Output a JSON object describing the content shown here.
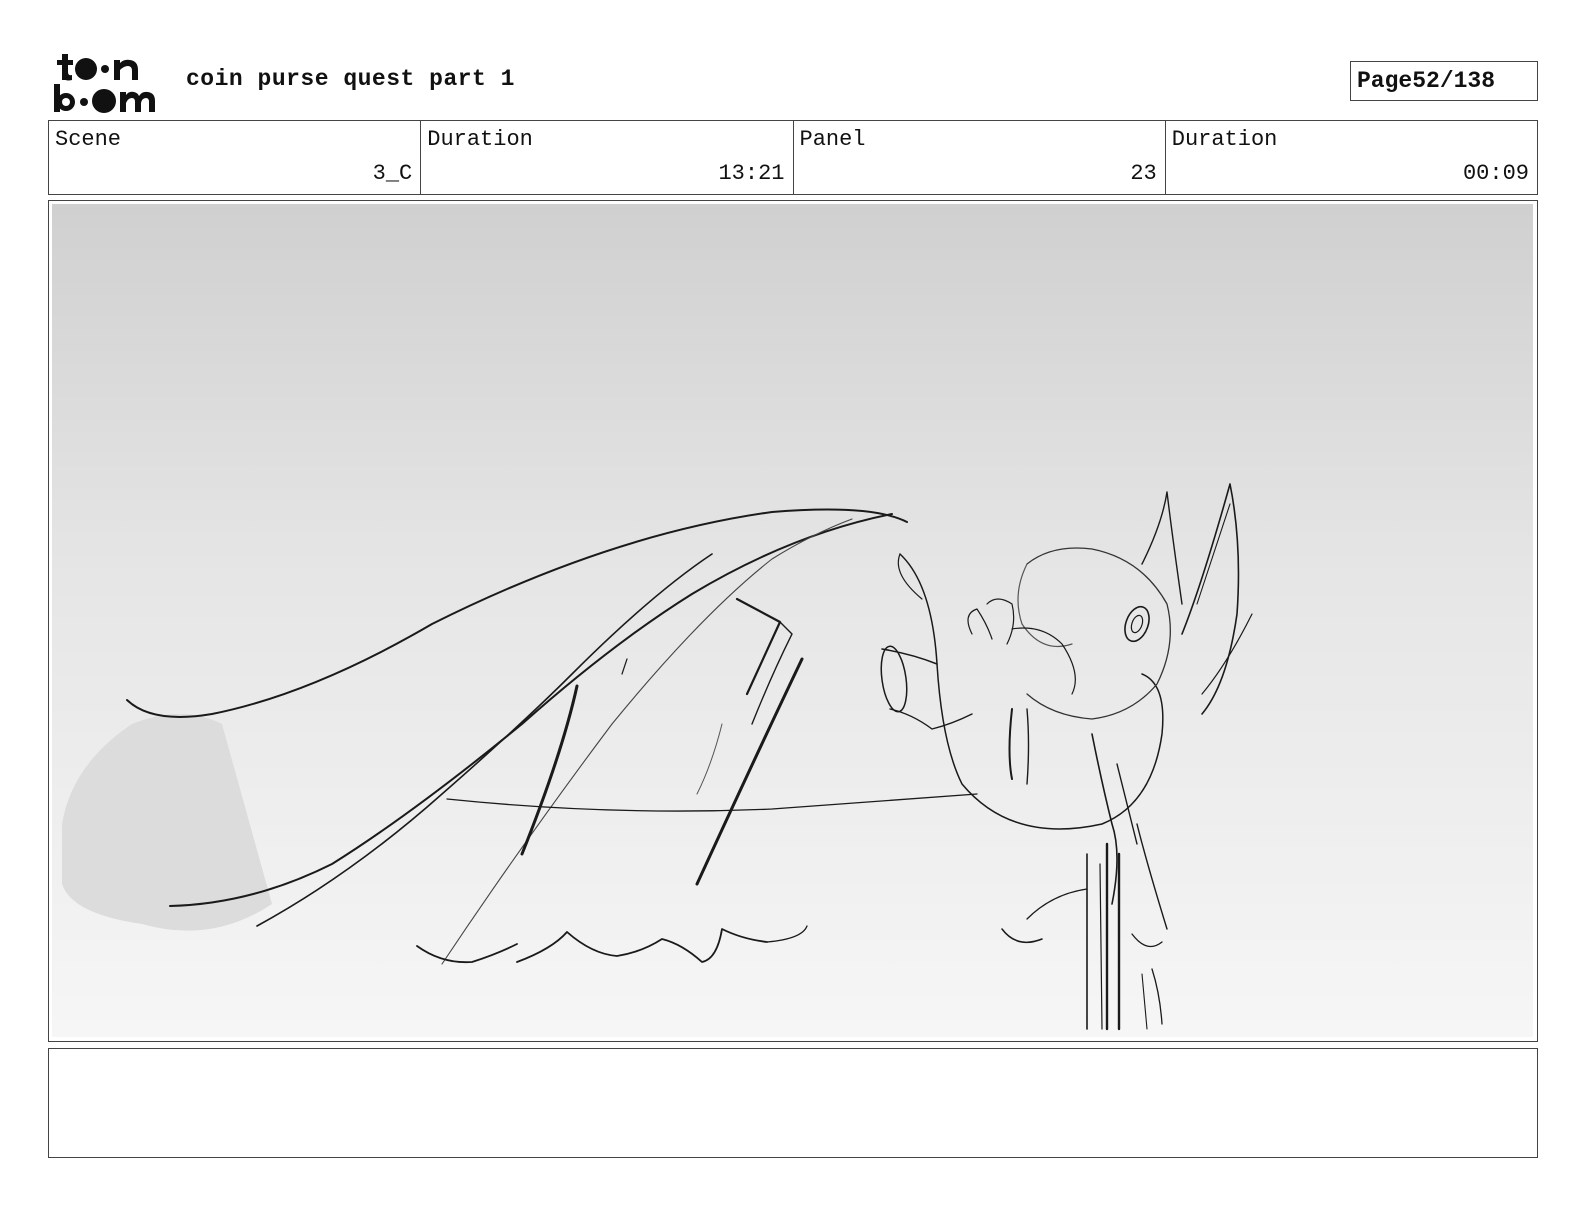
{
  "document": {
    "title": "coin purse quest part 1",
    "page_label": "Page",
    "page_number": "52/138"
  },
  "logo": {
    "icon": "toon-boom-logo"
  },
  "info": {
    "scene_label": "Scene",
    "scene_value": "3_C",
    "scene_duration_label": "Duration",
    "scene_duration_value": "13:21",
    "panel_label": "Panel",
    "panel_value": "23",
    "panel_duration_label": "Duration",
    "panel_duration_value": "00:09"
  },
  "panel_image": {
    "icon": "storyboard-sketch",
    "description_hidden": true
  },
  "notes": {
    "text": ""
  }
}
